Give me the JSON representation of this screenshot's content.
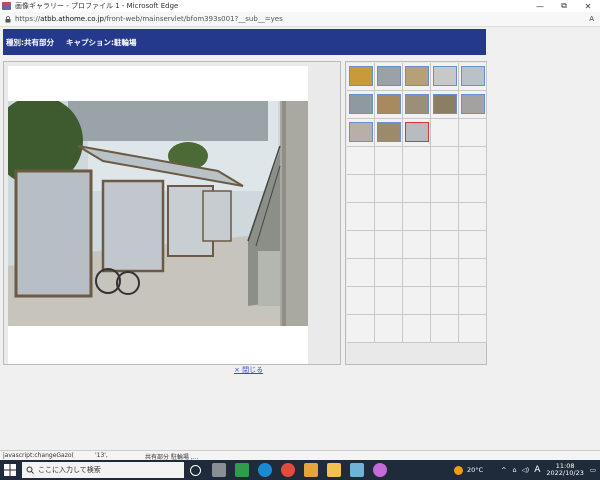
{
  "window": {
    "title": "画像ギャラリー - プロファイル 1 - Microsoft Edge",
    "controls": [
      "—",
      "⧉",
      "✕"
    ]
  },
  "address": {
    "url_prefix": "https://",
    "url_host": "atbb.athome.co.jp",
    "url_path": "/front-web/mainservlet/bfom393s001?__sub__=yes",
    "read_aloud": "A"
  },
  "header": {
    "type_label": "種別:共有部分",
    "caption_label": "キャプション:駐輪場"
  },
  "main": {
    "close_link": "× 閉じる"
  },
  "thumbnails": {
    "count": 13,
    "selected_index": 12,
    "colors": [
      "#c89a3a",
      "#9aa2a8",
      "#b5a079",
      "#c8c8c8",
      "#b9c3c7",
      "#8e99a0",
      "#a98a5e",
      "#9a8f78",
      "#8a7f63",
      "#a4a2a0",
      "#b8b0a6",
      "#9d8a6a",
      "#b8bcc0"
    ]
  },
  "status": {
    "script": "javascript:changeGazo(",
    "arg": "'13',",
    "caption": "共有部分 駐輪場 ,..."
  },
  "taskbar": {
    "search_placeholder": "ここに入力して検索",
    "temperature": "20°C",
    "ime": "A",
    "time": "11:08",
    "date": "2022/10/23"
  }
}
